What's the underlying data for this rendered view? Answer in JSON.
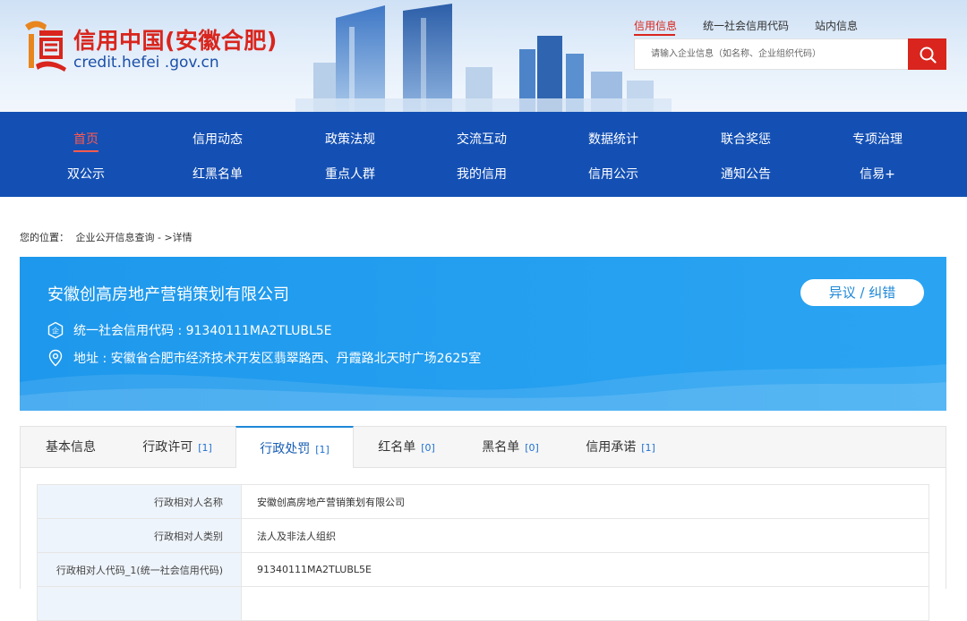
{
  "header": {
    "logo_title": "信用中国(安徽合肥)",
    "logo_domain": "credit.hefei .gov.cn",
    "top_links": [
      {
        "label": "信用信息",
        "active": true
      },
      {
        "label": "统一社会信用代码",
        "active": false
      },
      {
        "label": "站内信息",
        "active": false
      }
    ],
    "search_placeholder": "请输入企业信息（如名称、企业组织代码）",
    "accent_color": "#d9251d"
  },
  "nav": {
    "row1": [
      "首页",
      "信用动态",
      "政策法规",
      "交流互动",
      "数据统计",
      "联合奖惩",
      "专项治理"
    ],
    "row2": [
      "双公示",
      "红黑名单",
      "重点人群",
      "我的信用",
      "信用公示",
      "通知公告",
      "信易+"
    ],
    "active": "首页",
    "bg_color": "#1450b4"
  },
  "breadcrumb": {
    "prefix": "您的位置：",
    "path": "企业公开信息查询 - >详情"
  },
  "company": {
    "name": "安徽创高房地产营销策划有限公司",
    "dispute_label": "异议 / 纠错",
    "credit_code_line": "统一社会信用代码 : 91340111MA2TLUBL5E",
    "address_line": "地址 : 安徽省合肥市经济技术开发区翡翠路西、丹霞路北天时广场2625室"
  },
  "tabs": [
    {
      "label": "基本信息",
      "count": "",
      "active": false
    },
    {
      "label": "行政许可",
      "count": "[1]",
      "active": false
    },
    {
      "label": "行政处罚",
      "count": "[1]",
      "active": true
    },
    {
      "label": "红名单",
      "count": "[0]",
      "active": false
    },
    {
      "label": "黑名单",
      "count": "[0]",
      "active": false
    },
    {
      "label": "信用承诺",
      "count": "[1]",
      "active": false
    }
  ],
  "detail_rows": [
    {
      "label": "行政相对人名称",
      "value": "安徽创高房地产营销策划有限公司"
    },
    {
      "label": "行政相对人类别",
      "value": "法人及非法人组织"
    },
    {
      "label": "行政相对人代码_1(统一社会信用代码)",
      "value": "91340111MA2TLUBL5E"
    }
  ]
}
